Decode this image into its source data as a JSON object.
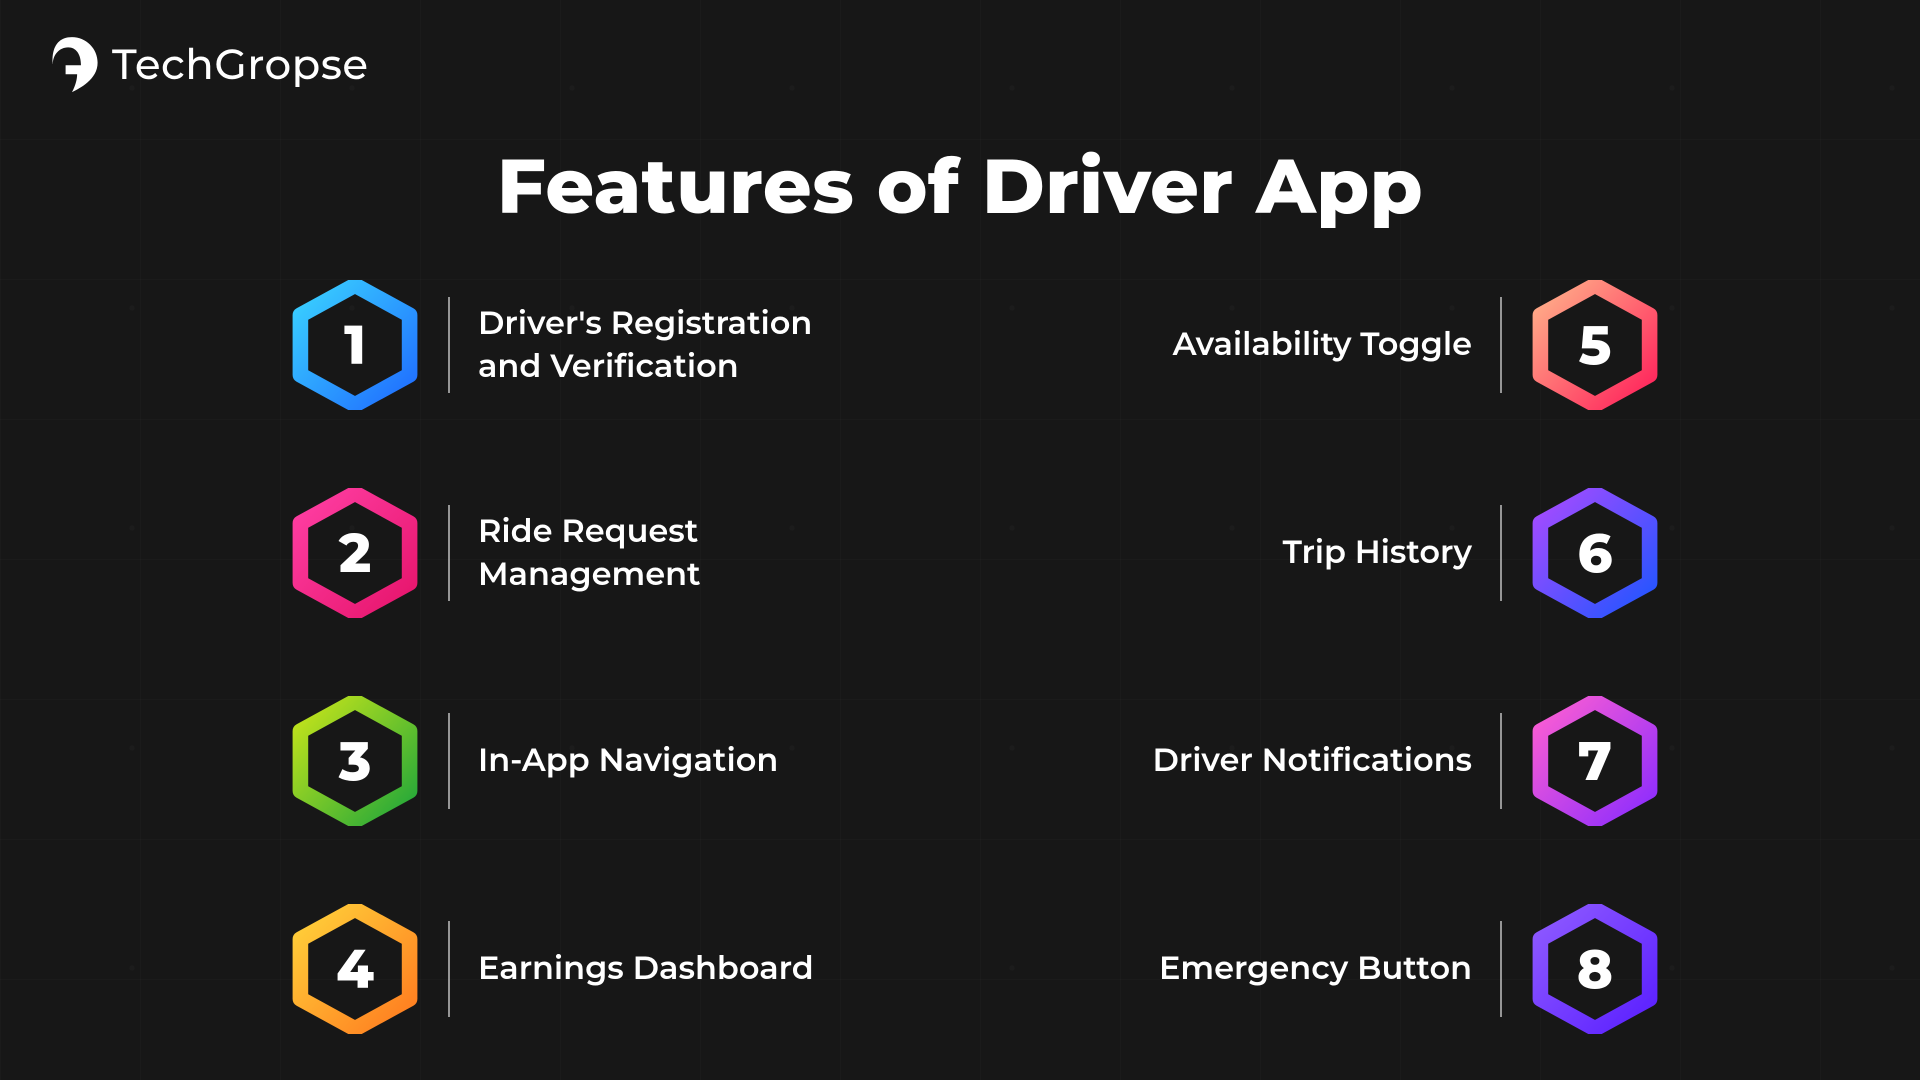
{
  "brand": {
    "name": "TechGropse"
  },
  "title": "Features of Driver App",
  "features_left": [
    {
      "n": "1",
      "label": "Driver's Registration and Verification",
      "grad": [
        "#3ad2ff",
        "#1f6cff"
      ]
    },
    {
      "n": "2",
      "label": "Ride Request Management",
      "grad": [
        "#ff3fa4",
        "#e6146b"
      ]
    },
    {
      "n": "3",
      "label": "In-App Navigation",
      "grad": [
        "#c8e51a",
        "#1fa63a"
      ]
    },
    {
      "n": "4",
      "label": "Earnings Dashboard",
      "grad": [
        "#ffd23a",
        "#ff7a1f"
      ]
    }
  ],
  "features_right": [
    {
      "n": "5",
      "label": "Availability Toggle",
      "grad": [
        "#ffb28a",
        "#ff1f5a"
      ]
    },
    {
      "n": "6",
      "label": "Trip History",
      "grad": [
        "#a94bff",
        "#1f55ff"
      ]
    },
    {
      "n": "7",
      "label": "Driver Notifications",
      "grad": [
        "#ff5fd2",
        "#8a2bff"
      ]
    },
    {
      "n": "8",
      "label": "Emergency Button",
      "grad": [
        "#8f5bff",
        "#5a1fff"
      ]
    }
  ]
}
